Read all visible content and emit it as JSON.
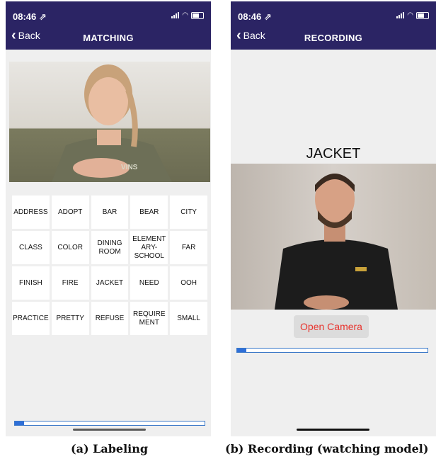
{
  "labeling": {
    "status_time": "08:46 ⇗",
    "back_label": "Back",
    "title": "MATCHING",
    "words": [
      "ADDRESS",
      "ADOPT",
      "BAR",
      "BEAR",
      "CITY",
      "CLASS",
      "COLOR",
      "DINING ROOM",
      "ELEMENT ARY- SCHOOL",
      "FAR",
      "FINISH",
      "FIRE",
      "JACKET",
      "NEED",
      "OOH",
      "PRACTICE",
      "PRETTY",
      "REFUSE",
      "REQUIRE MENT",
      "SMALL"
    ],
    "progress": 0.05
  },
  "recording": {
    "status_time": "08:46 ⇗",
    "back_label": "Back",
    "title": "RECORDING",
    "word": "JACKET",
    "open_camera_label": "Open Camera",
    "progress": 0.05
  },
  "captions": {
    "a": "(a) Labeling",
    "b": "(b) Recording (watching model)"
  },
  "colors": {
    "navbar": "#2b2464",
    "background": "#efefef",
    "progress": "#2e6fd8",
    "open_camera_text": "#e8322c"
  }
}
